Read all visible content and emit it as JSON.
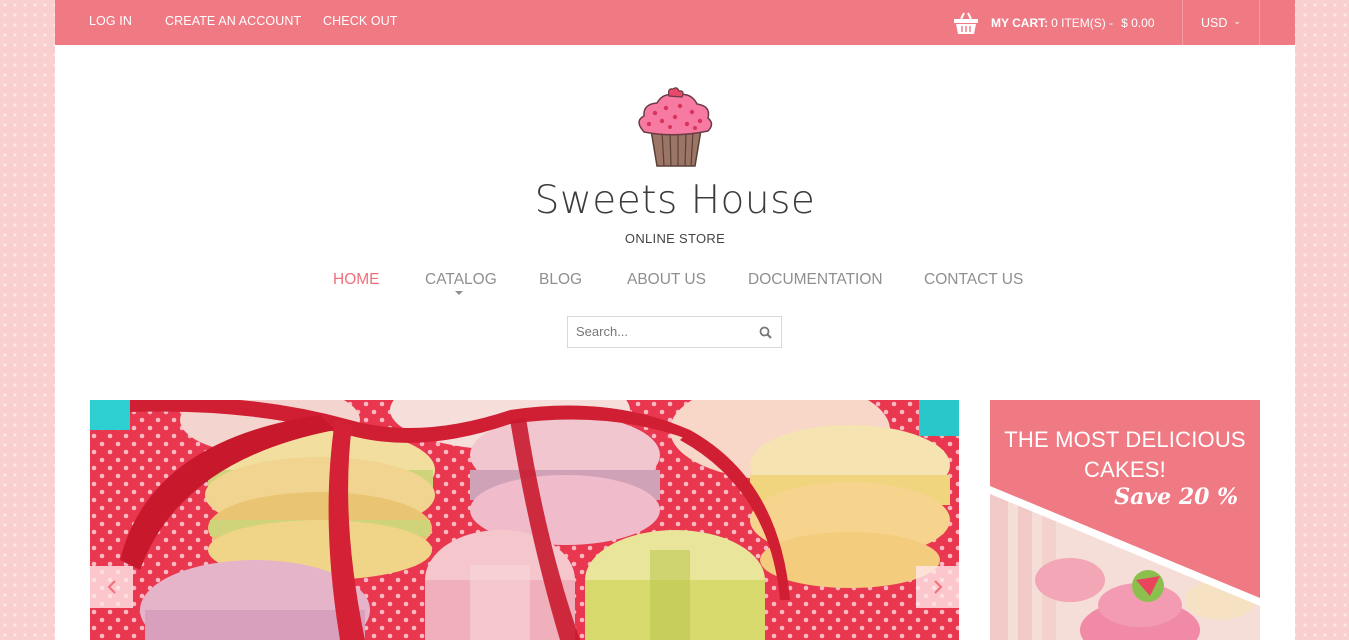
{
  "topbar": {
    "login": "LOG IN",
    "create_account": "CREATE AN ACCOUNT",
    "checkout": "CHECK OUT",
    "cart_label": "MY CART:",
    "cart_items": "0 ITEM(S) -",
    "cart_total": "$ 0.00",
    "currency": "USD",
    "cart_icon": "basket-icon",
    "currency_icon": "chevron-down-icon"
  },
  "header": {
    "logo_icon": "cupcake-logo",
    "title": "Sweets House",
    "subtitle": "ONLINE STORE"
  },
  "nav": {
    "items": [
      {
        "label": "HOME",
        "active": true
      },
      {
        "label": "CATALOG",
        "has_dropdown": true
      },
      {
        "label": "BLOG"
      },
      {
        "label": "ABOUT US"
      },
      {
        "label": "DOCUMENTATION"
      },
      {
        "label": "CONTACT US"
      }
    ]
  },
  "search": {
    "placeholder": "Search...",
    "icon": "search-icon"
  },
  "slider": {
    "prev_icon": "chevron-left-icon",
    "next_icon": "chevron-right-icon"
  },
  "promo": {
    "title": "THE MOST DELICIOUS CAKES!",
    "save": "Save 20 %"
  },
  "colors": {
    "accent": "#f07a84",
    "active_nav": "#ef6f7a",
    "nav_text": "#8f8f8f"
  }
}
